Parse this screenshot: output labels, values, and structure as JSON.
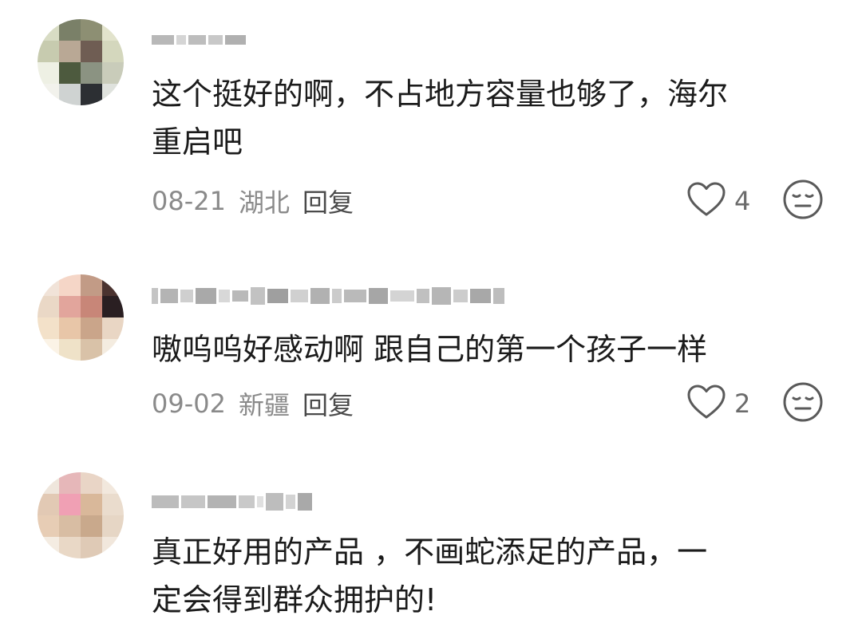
{
  "comments": [
    {
      "text": "这个挺好的啊，不占地方容量也够了，海尔\n重启吧",
      "date": "08-21",
      "location": "湖北",
      "reply_label": "回复",
      "likes": "4",
      "avatar_icon": "user-avatar-blurred",
      "like_icon": "heart-outline-icon",
      "dislike_icon": "meh-face-icon"
    },
    {
      "text": "嗷呜呜好感动啊 跟自己的第一个孩子一样",
      "date": "09-02",
      "location": "新疆",
      "reply_label": "回复",
      "likes": "2",
      "avatar_icon": "user-avatar-blurred",
      "like_icon": "heart-outline-icon",
      "dislike_icon": "meh-face-icon"
    },
    {
      "text": "真正好用的产品 ，不画蛇添足的产品，一\n定会得到群众拥护的!",
      "avatar_icon": "user-avatar-blurred"
    }
  ],
  "colors": {
    "text": "#1b1b1b",
    "meta": "#8a8a8a",
    "reply": "#4a4a4a",
    "icon": "#5a5a5a"
  }
}
